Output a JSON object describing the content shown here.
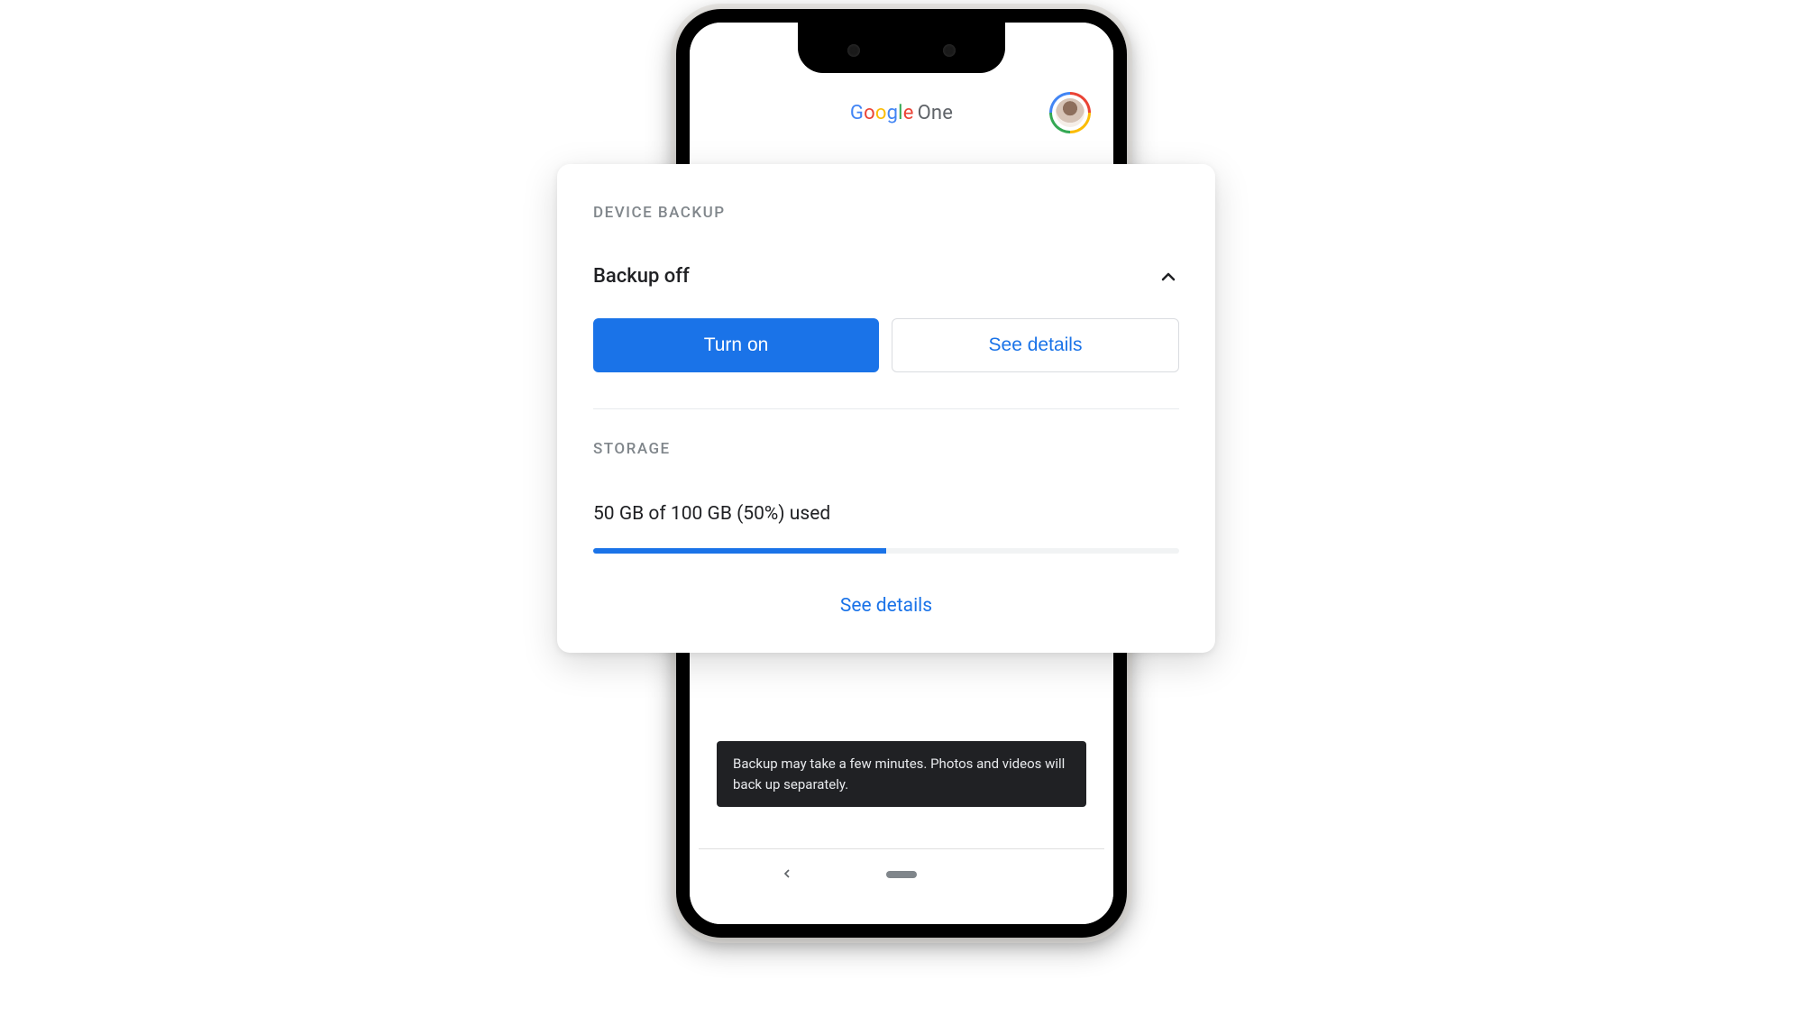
{
  "app": {
    "brand_first": "Google",
    "brand_second": "One"
  },
  "card": {
    "device_backup_label": "DEVICE BACKUP",
    "backup_status": "Backup off",
    "turn_on_label": "Turn on",
    "see_details_label": "See details",
    "storage_label": "STORAGE",
    "storage_text": "50 GB of 100 GB (50%) used",
    "storage_percent": 50,
    "storage_details_label": "See details"
  },
  "toast": {
    "message": "Backup may take a few minutes. Photos and videos will back up separately."
  },
  "colors": {
    "primary": "#1a73e8",
    "text": "#202124",
    "muted": "#80868b"
  }
}
